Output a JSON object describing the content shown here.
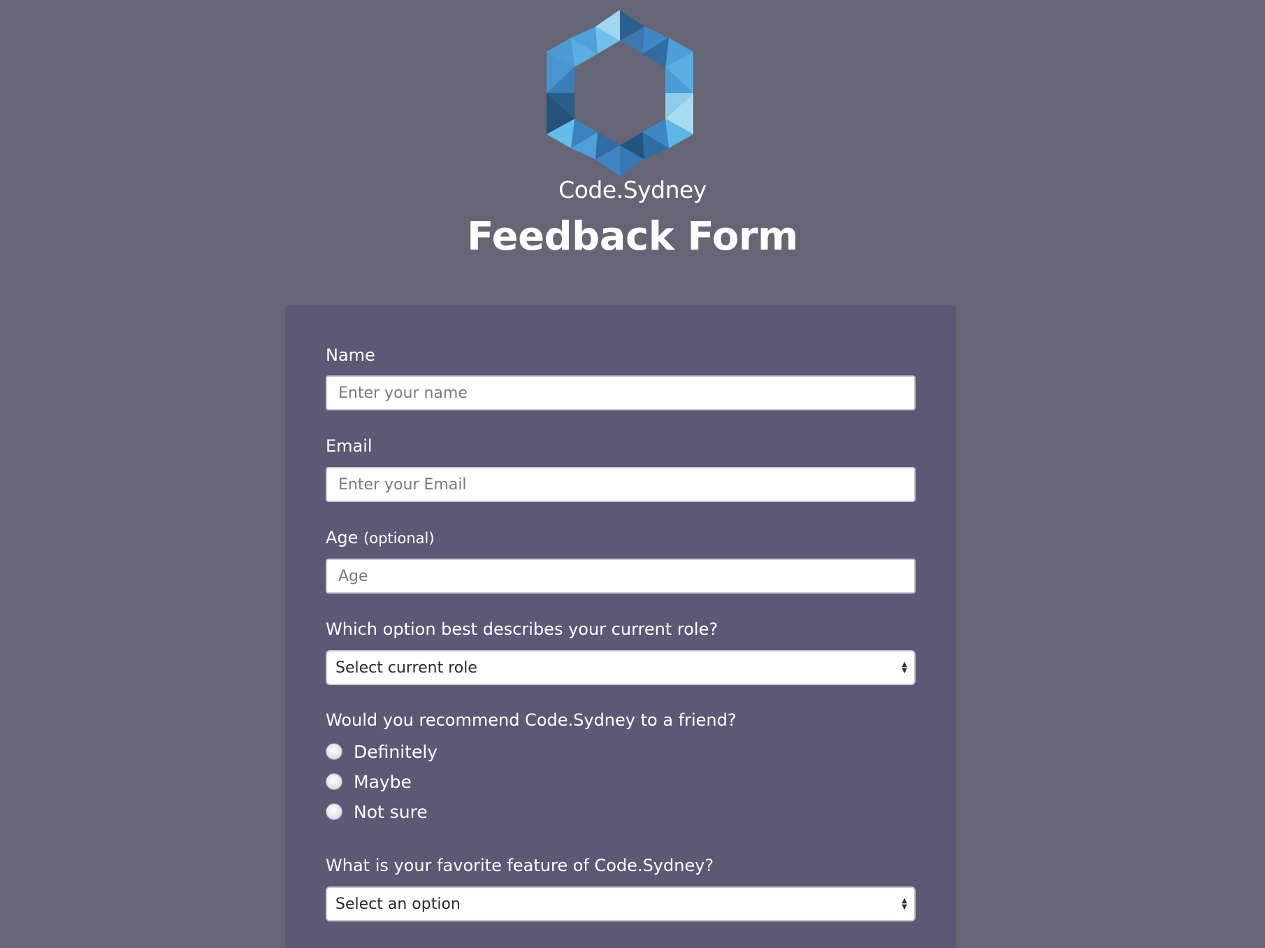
{
  "brand": {
    "name": "Code.Sydney",
    "logo_icon": "hexagon-logo-icon",
    "colors": [
      "#1f5a8f",
      "#3c86c6",
      "#5aa9e0",
      "#9fd3ee"
    ]
  },
  "header": {
    "title": "Feedback Form"
  },
  "form": {
    "name": {
      "label": "Name",
      "placeholder": "Enter your name"
    },
    "email": {
      "label": "Email",
      "placeholder": "Enter your Email"
    },
    "age": {
      "label": "Age",
      "optional_note": "(optional)",
      "placeholder": "Age"
    },
    "role": {
      "label": "Which option best describes your current role?",
      "selected": "Select current role"
    },
    "recommend": {
      "label": "Would you recommend Code.Sydney to a friend?",
      "options": [
        "Definitely",
        "Maybe",
        "Not sure"
      ]
    },
    "feature": {
      "label": "What is your favorite feature of Code.Sydney?",
      "selected": "Select an option"
    }
  },
  "colors": {
    "page_background": "#656575",
    "card_background": "#5a5a76",
    "text": "#ffffff"
  }
}
